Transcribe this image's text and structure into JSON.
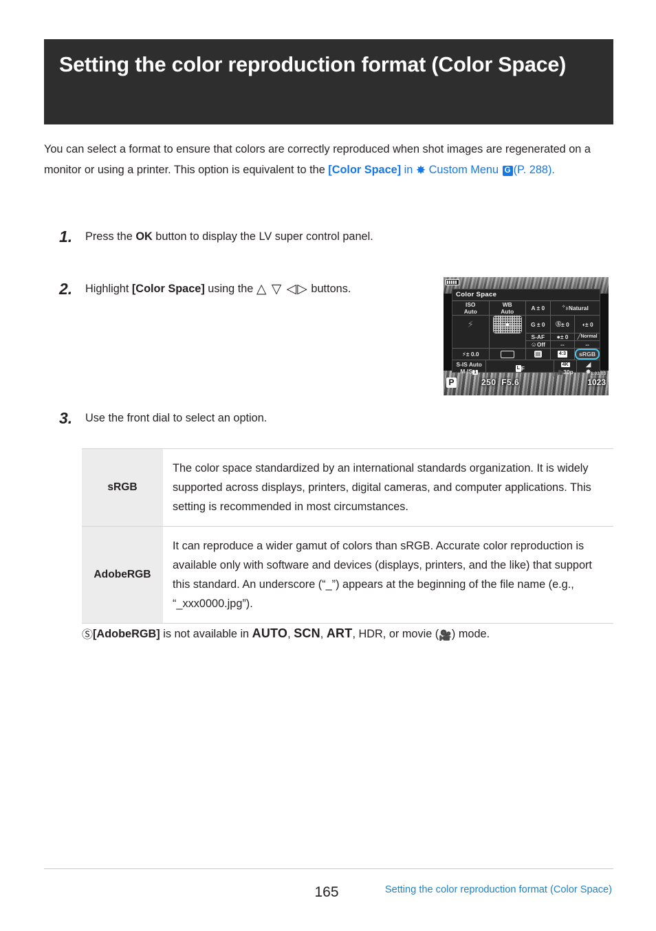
{
  "title": "Setting the color reproduction format (Color Space)",
  "intro": {
    "part1": "You can select a format to ensure that colors are correctly reproduced when shot images are regenerated on a monitor or using a printer. This option is equivalent to the ",
    "link_bracket": "[Color Space]",
    "part2": " in ",
    "gear_icon": "gear-icon",
    "custom_menu": "Custom Menu",
    "badge": "G",
    "page_ref": "(P. 288)",
    "period": "."
  },
  "steps": [
    {
      "num": "1.",
      "pre": "Press the ",
      "bold": "OK",
      "post": " button to display the LV super control panel."
    },
    {
      "num": "2.",
      "pre": "Highlight ",
      "bold": "[Color Space]",
      "mid": " using the ",
      "arrows": "△ ▽ ◁▷",
      "post": " buttons."
    },
    {
      "num": "3.",
      "pre": "Use the front dial to select an option.",
      "bold": "",
      "post": ""
    }
  ],
  "lcd": {
    "title": "Color Space",
    "battery_icon": "battery-icon",
    "rows": [
      [
        "ISO\nAuto",
        "WB\nAuto",
        "A ± 0",
        "Natural"
      ],
      [
        "G ± 0",
        "S ± 0",
        "± 0"
      ],
      [
        "S-AF",
        "± 0",
        "Normal"
      ],
      [
        "Off",
        "--",
        "--"
      ]
    ],
    "cells": {
      "iso": "ISO",
      "iso_val": "Auto",
      "wb": "WB",
      "wb_val": "Auto",
      "a_shift": "A ± 0",
      "g_shift": "G ± 0",
      "picture_mode": "Natural",
      "picture_mode_num": "3",
      "sharpness": "± 0",
      "contrast": "± 0",
      "af_mode": "S-AF",
      "saturation": "± 0",
      "gradation": "Normal",
      "face_priority": "Off",
      "dash1": "--",
      "dash2": "--",
      "flash_icon": "flash-icon",
      "flash_comp": "± 0.0",
      "drive_icon": "drive-single-icon",
      "metering_icon": "metering-icon",
      "aspect": "4:3",
      "color_space": "sRGB",
      "is_mode": "S-IS Auto",
      "m_is": "M-IS",
      "m_is_val": "1",
      "quality": "F",
      "quality_prefix": "L",
      "movie_res": "4K",
      "movie_fps": "30p",
      "highlight_shadow_icon": "highlight-shadow-icon",
      "assist_icon": "gear-icon"
    },
    "mode": "P",
    "shutter": "250",
    "aperture": "F5.6",
    "clock": "1:02:03",
    "frames": "1023",
    "selected_item": "sRGB",
    "highlight_color": "#4fc3e8"
  },
  "options_table": {
    "rows": [
      {
        "name": "sRGB",
        "description": "The color space standardized by an international standards organization. It is widely supported across displays, printers, digital cameras, and computer applications. This setting is recommended in most circumstances."
      },
      {
        "name": "AdobeRGB",
        "description": "It can reproduce a wider gamut of colors than sRGB. Accurate color reproduction is available only with software and devices (displays, printers, and the like) that support this standard. An underscore (“_”) appears at the beginning of the file name (e.g., “_xxx0000.jpg”)."
      }
    ]
  },
  "note": {
    "icon": "info-icon",
    "bold_option": "[AdobeRGB]",
    "text1": " is not available in ",
    "auto": "AUTO",
    "sep1": ", ",
    "scn": "SCN",
    "sep2": ", ",
    "art": "ART",
    "text2": ", HDR, or movie (",
    "movie_icon": "movie-camera-icon",
    "text3": ") mode."
  },
  "footer": {
    "page_number": "165",
    "link": "Setting the color reproduction format (Color Space)"
  },
  "colors": {
    "banner_bg": "#2e2e2e",
    "link_blue": "#1478e6",
    "footer_blue": "#1f80c4",
    "table_name_bg": "#ececec"
  }
}
